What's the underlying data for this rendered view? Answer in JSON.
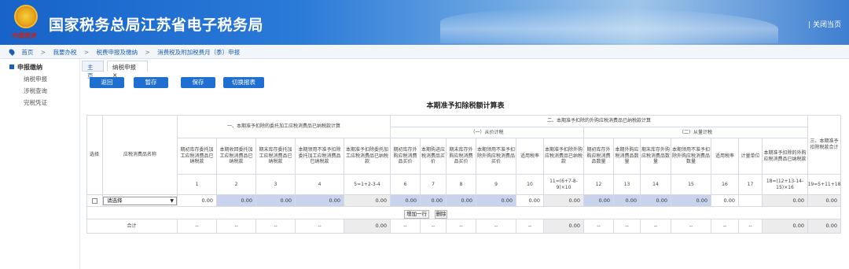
{
  "header": {
    "title": "国家税务总局江苏省电子税务局",
    "emblem_caption": "中国税务",
    "close_link": "| 关闭当页"
  },
  "breadcrumb": [
    "首页",
    ">",
    "我要办税",
    ">",
    "税费申报及缴纳",
    ">",
    "消费税及附加税费月（季）申报"
  ],
  "sidebar": {
    "head": "申报缴纳",
    "items": [
      "纳税申报",
      "涉税查询",
      "完税凭证"
    ]
  },
  "tabs": [
    {
      "label": "主页"
    },
    {
      "label": "纳税申报 ×"
    }
  ],
  "toolbar": {
    "back": "返回",
    "save_draft": "暂存",
    "save": "保存",
    "switch": "切换报表"
  },
  "table": {
    "title": "本期准予扣除税额计算表",
    "col_select": "选择",
    "col_name": "应税消费品名称",
    "group1": "一、本期准予扣除的委托加工应税消费品已纳税款计算",
    "group2": "二、本期准予扣除的外购应税消费品已纳税款计算",
    "group2a": "（一）从价计税",
    "group2b": "（二）从量计税",
    "group3": "三、本期准予扣除税款合计",
    "headers": [
      "期初库存委托加工应税消费品已纳税款",
      "本期收回委托加工应税消费品已纳税款",
      "期末库存委托加工应税消费品已纳税款",
      "本期领用不准予扣除委托加工应税消费品已纳税款",
      "本期准予扣除委托加工应税消费品已纳税款",
      "期初库存外购应税消费品买价",
      "本期购进应税消费品买价",
      "期末库存外购应税消费品买价",
      "本期领用不准予扣除外购应税消费品买价",
      "适用税率",
      "本期准予扣除外购应税消费品已纳税款",
      "期初库存外购应税消费品数量",
      "本期外购应税消费品数量",
      "期末库存外购应税消费品数量",
      "本期领用不准予扣除外购应税消费品数量",
      "适用税率",
      "计量单位",
      "本期准予扣除的外购应税消费品已纳税款"
    ],
    "col_numbers": [
      "1",
      "2",
      "3",
      "4",
      "5=1+2-3-4",
      "6",
      "7",
      "8",
      "9",
      "10",
      "11=(6+7-8-9)×10",
      "12",
      "13",
      "14",
      "15",
      "16",
      "17",
      "18=(12+13-14-15)×16",
      "19=5+11+18"
    ],
    "select_value": "请选择",
    "data_row": [
      "0.00",
      "0.00",
      "0.00",
      "0.00",
      "0.00",
      "0.00",
      "0.00",
      "0.00",
      "0.00",
      "0.00",
      "0.00",
      "0.00",
      "0.00",
      "0.00",
      "0.00",
      "0.00",
      "",
      "0.00",
      "0.00"
    ],
    "add_row": "增加一行",
    "delete_row": "删除",
    "total_label": "合计",
    "total_row": [
      "--",
      "--",
      "--",
      "--",
      "0.00",
      "--",
      "--",
      "--",
      "--",
      "--",
      "0.00",
      "--",
      "--",
      "--",
      "--",
      "--",
      "--",
      "0.00",
      "0.00"
    ]
  }
}
